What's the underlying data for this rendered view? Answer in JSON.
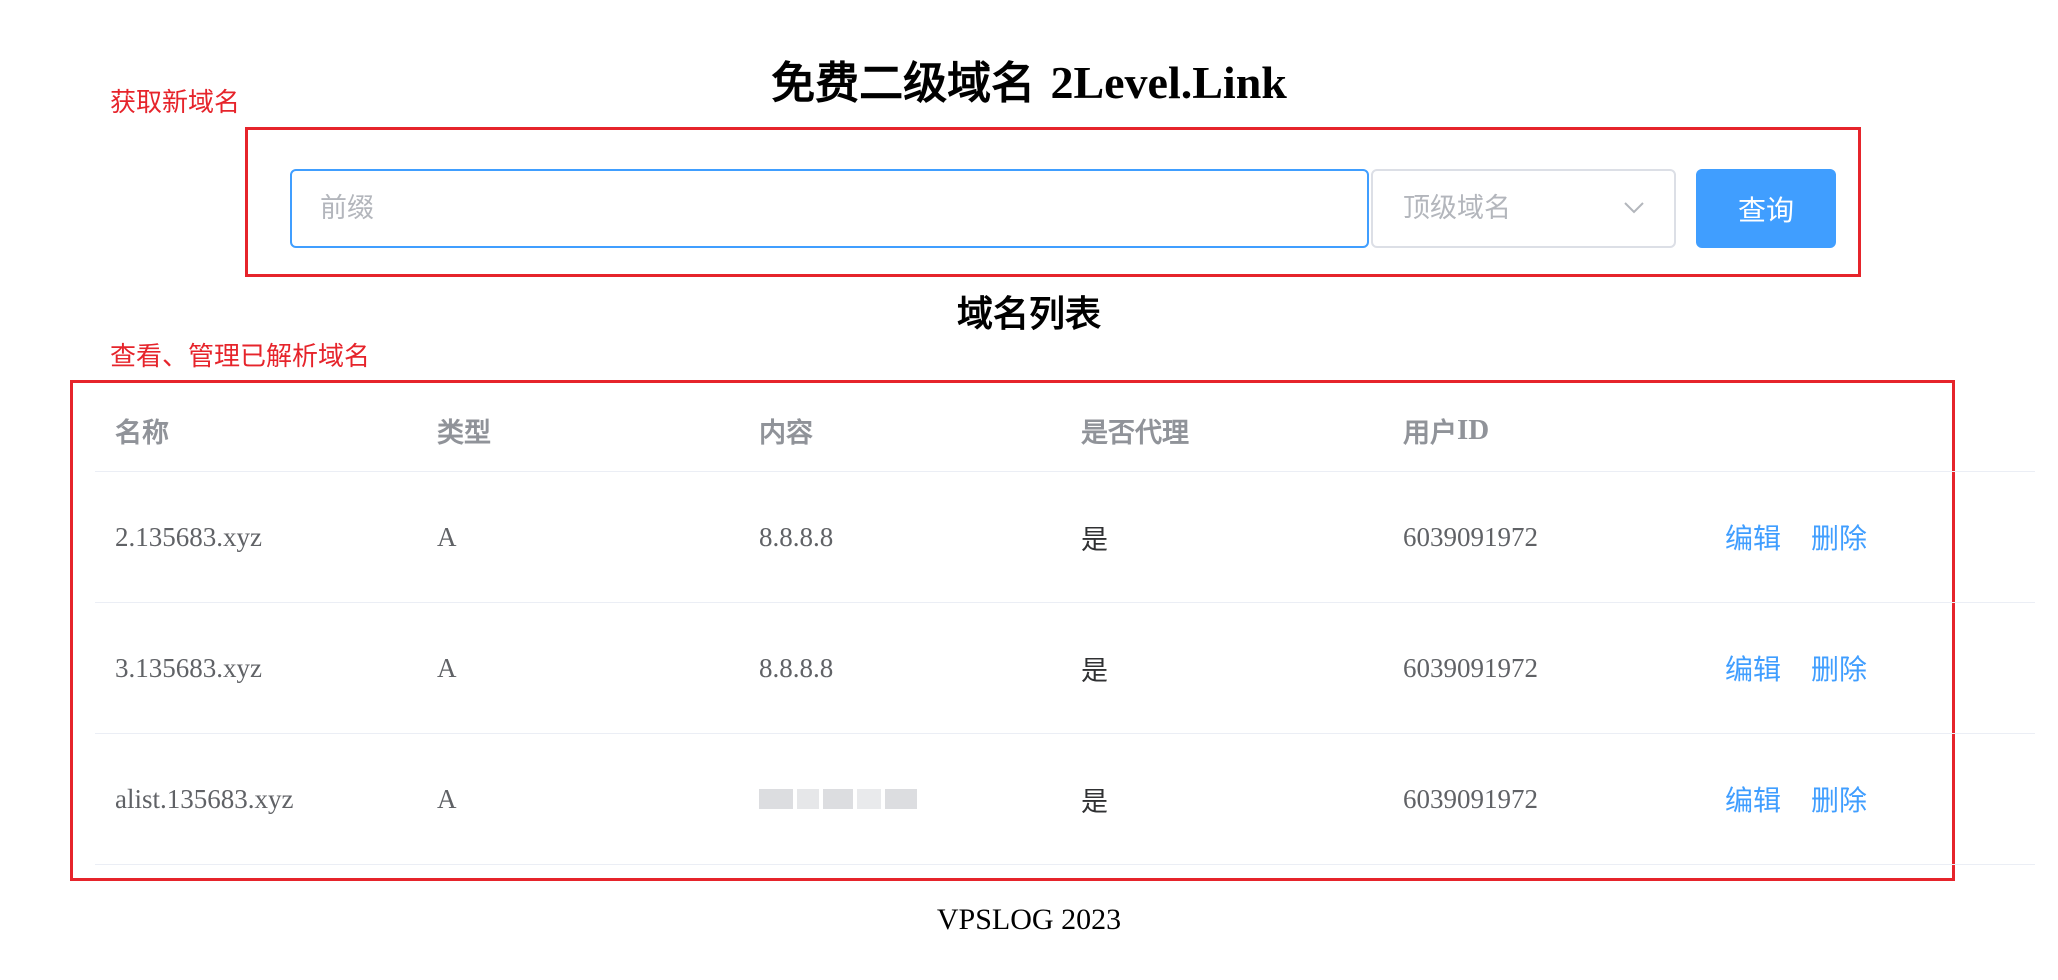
{
  "header": {
    "title_cjk": "免费二级域名",
    "title_latin": "2Level.Link"
  },
  "annotations": {
    "get_new_domain": "获取新域名",
    "view_manage_domains": "查看、管理已解析域名"
  },
  "form": {
    "prefix_placeholder": "前缀",
    "tld_placeholder": "顶级域名",
    "query_label": "查询"
  },
  "list": {
    "title": "域名列表",
    "columns": {
      "name": "名称",
      "type": "类型",
      "content": "内容",
      "proxied": "是否代理",
      "user_id_cjk": "用户",
      "user_id_latin": "ID"
    },
    "actions": {
      "edit": "编辑",
      "delete": "删除"
    },
    "rows": [
      {
        "name": "2.135683.xyz",
        "type": "A",
        "content": "8.8.8.8",
        "proxied": "是",
        "user_id": "6039091972"
      },
      {
        "name": "3.135683.xyz",
        "type": "A",
        "content": "8.8.8.8",
        "proxied": "是",
        "user_id": "6039091972"
      },
      {
        "name": "alist.135683.xyz",
        "type": "A",
        "content": "",
        "proxied": "是",
        "user_id": "6039091972"
      }
    ]
  },
  "footer": {
    "text": "VPSLOG 2023"
  },
  "colors": {
    "accent": "#409eff",
    "annotation_red": "#e6242b",
    "header_text": "#909399",
    "border": "#ebeef5"
  },
  "icons": {
    "select_arrow": "chevron-down-icon"
  }
}
